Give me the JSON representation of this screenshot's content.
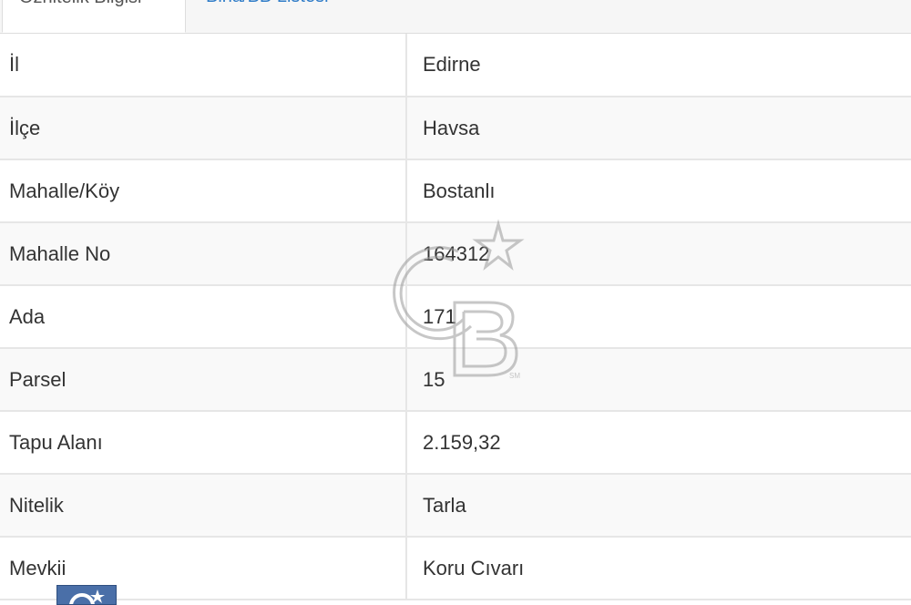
{
  "tabs": [
    {
      "label": "Öznitelik Bilgisi",
      "active": true
    },
    {
      "label": "Bina/BB Listesi",
      "active": false
    }
  ],
  "rows": [
    {
      "key": "İl",
      "value": "Edirne"
    },
    {
      "key": "İlçe",
      "value": "Havsa"
    },
    {
      "key": "Mahalle/Köy",
      "value": "Bostanlı"
    },
    {
      "key": "Mahalle No",
      "value": "164312"
    },
    {
      "key": "Ada",
      "value": "171"
    },
    {
      "key": "Parsel",
      "value": "15"
    },
    {
      "key": "Tapu Alanı",
      "value": "2.159,32"
    },
    {
      "key": "Nitelik",
      "value": "Tarla"
    },
    {
      "key": "Mevkii",
      "value": "Koru Cıvarı"
    }
  ],
  "watermark": {
    "text": "CB",
    "mark": "SM",
    "icon": "coldwell-banker-logo"
  },
  "colors": {
    "tab_link": "#2f7cc8",
    "border": "#e6e6e6",
    "text": "#333333"
  }
}
